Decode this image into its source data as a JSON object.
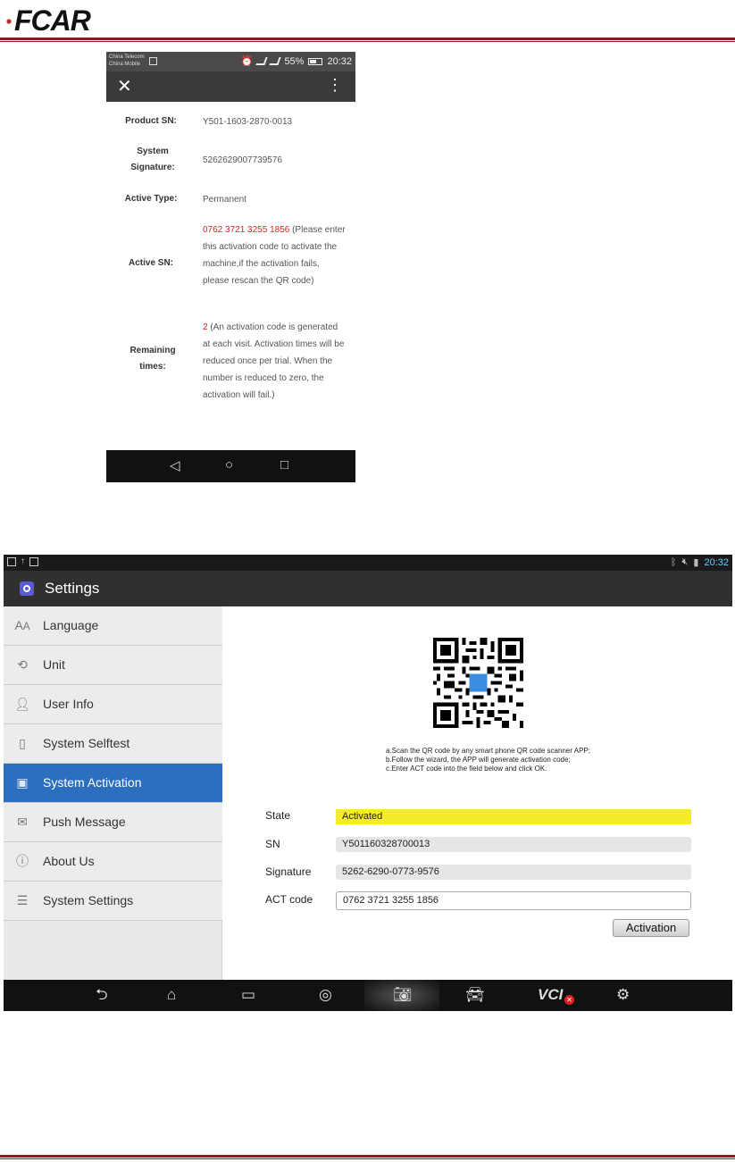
{
  "document": {
    "logo_text": "FCAR"
  },
  "phone": {
    "status": {
      "carrier1": "China Telecom",
      "carrier2": "China Mobile",
      "battery": "55%",
      "time": "20:32"
    },
    "fields": [
      {
        "label": "Product SN:",
        "value": "Y501-1603-2870-0013"
      },
      {
        "label": "System Signature:",
        "value": "5262629007739576"
      },
      {
        "label": "Active Type:",
        "value": "Permanent"
      },
      {
        "label": "Active SN:",
        "value_highlight": "0762 3721 3255 1856",
        "value": " (Please enter this activation code to activate the machine,if the activation fails, please rescan the QR code)"
      },
      {
        "label": "Remaining times:",
        "value_highlight": "2",
        "value": " (An activation code is generated at each visit. Activation times will be reduced once per trial. When the number is reduced to zero, the activation will fail.)"
      }
    ]
  },
  "tablet": {
    "status_time": "20:32",
    "title": "Settings",
    "menu": [
      {
        "label": "Language",
        "icon": "language-icon"
      },
      {
        "label": "Unit",
        "icon": "unit-icon"
      },
      {
        "label": "User Info",
        "icon": "user-icon"
      },
      {
        "label": "System Selftest",
        "icon": "selftest-icon"
      },
      {
        "label": "System Activation",
        "icon": "activation-icon",
        "active": true
      },
      {
        "label": "Push Message",
        "icon": "message-icon"
      },
      {
        "label": "About Us",
        "icon": "info-icon"
      },
      {
        "label": "System Settings",
        "icon": "sliders-icon"
      }
    ],
    "instructions": [
      "a.Scan the QR code by any smart phone QR code scanner APP;",
      "b.Follow the wizard, the APP will generate activation code;",
      "c.Enter ACT code into the field below and click OK."
    ],
    "form": {
      "state_label": "State",
      "state_value": "Activated",
      "sn_label": "SN",
      "sn_value": "Y501160328700013",
      "signature_label": "Signature",
      "signature_value": "5262-6290-0773-9576",
      "act_label": "ACT code",
      "act_value": "0762 3721 3255 1856",
      "button": "Activation"
    },
    "nav_vci": "VCI",
    "accent_color": "#2c6fbf",
    "state_color": "#f4ec2a"
  }
}
